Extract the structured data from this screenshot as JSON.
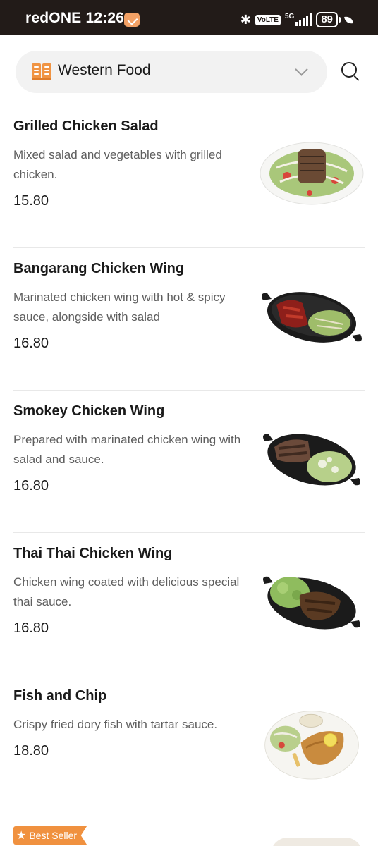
{
  "status_bar": {
    "carrier": "redONE",
    "time": "12:26",
    "volte": "VoLTE",
    "network": "5G",
    "battery": "89"
  },
  "header": {
    "category": "Western Food",
    "icons": [
      "book-icon",
      "chevron-down-icon",
      "search-icon"
    ]
  },
  "menu": {
    "items": [
      {
        "name": "Grilled Chicken Salad",
        "description": "Mixed salad and vegetables with grilled chicken.",
        "price": "15.80"
      },
      {
        "name": "Bangarang Chicken Wing",
        "description": "Marinated chicken wing with hot & spicy sauce, alongside with salad",
        "price": "16.80"
      },
      {
        "name": "Smokey Chicken Wing",
        "description": "Prepared with marinated chicken wing with salad and sauce.",
        "price": "16.80"
      },
      {
        "name": "Thai Thai Chicken Wing",
        "description": "Chicken wing coated with delicious special thai sauce.",
        "price": "16.80"
      },
      {
        "name": "Fish and Chip",
        "description": "Crispy fried dory fish with tartar sauce.",
        "price": "18.80"
      }
    ]
  },
  "badge": {
    "label": "Best Seller"
  },
  "colors": {
    "accent": "#f0913f",
    "status_bar": "#221b18",
    "pill_bg": "#f2f2f2"
  }
}
